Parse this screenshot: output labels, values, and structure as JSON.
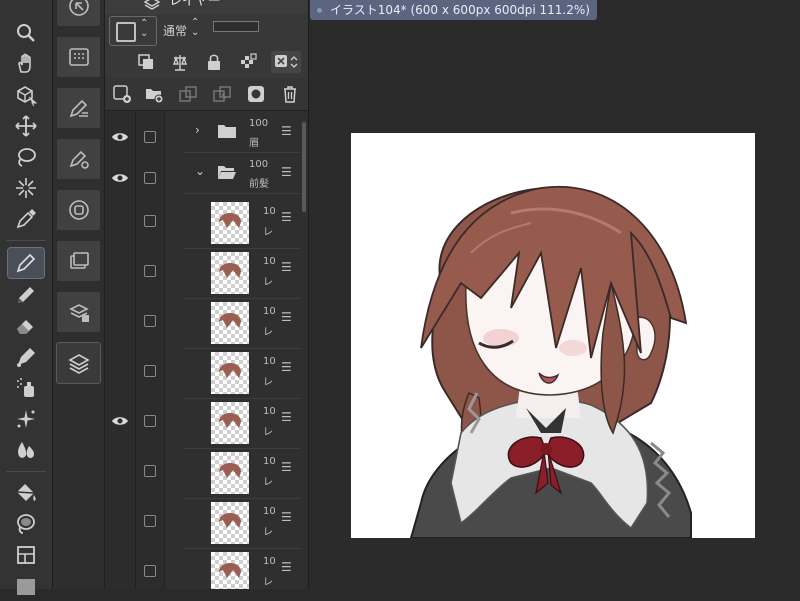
{
  "panel": {
    "title": "レイヤー",
    "blend_mode": "通常"
  },
  "document": {
    "tab_title": "イラスト104* (600 x 600px 600dpi 111.2%)"
  },
  "layers": [
    {
      "type": "folder",
      "expanded": false,
      "eye": true,
      "name_line1": "100",
      "name_line2": "眉"
    },
    {
      "type": "folder",
      "expanded": true,
      "eye": true,
      "name_line1": "100",
      "name_line2": "前髪"
    },
    {
      "type": "layer",
      "eye": false,
      "name_line1": "10",
      "name_line2": "レ"
    },
    {
      "type": "layer",
      "eye": false,
      "name_line1": "10",
      "name_line2": "レ"
    },
    {
      "type": "layer",
      "eye": false,
      "name_line1": "10",
      "name_line2": "レ"
    },
    {
      "type": "layer",
      "eye": false,
      "name_line1": "10",
      "name_line2": "レ"
    },
    {
      "type": "layer",
      "eye": true,
      "name_line1": "10",
      "name_line2": "レ"
    },
    {
      "type": "layer",
      "eye": false,
      "name_line1": "10",
      "name_line2": "レ"
    },
    {
      "type": "layer",
      "eye": false,
      "name_line1": "10",
      "name_line2": "レ"
    },
    {
      "type": "layer",
      "eye": false,
      "name_line1": "10",
      "name_line2": "レ"
    }
  ],
  "tools": [
    "zoom-icon",
    "hand-icon",
    "object-icon",
    "move-icon",
    "lasso-icon",
    "magic-wand-icon",
    "eyedropper-icon",
    "pen-icon",
    "pencil-icon",
    "eraser-icon",
    "decoration-icon",
    "airbrush-icon",
    "sparkle-icon",
    "blend-icon",
    "fill-icon",
    "gradient-icon",
    "figure-icon",
    "frame-icon"
  ],
  "colors": {
    "accent": "#5c6580",
    "panel": "#2f2f2f",
    "hair": "#9a5f52"
  }
}
